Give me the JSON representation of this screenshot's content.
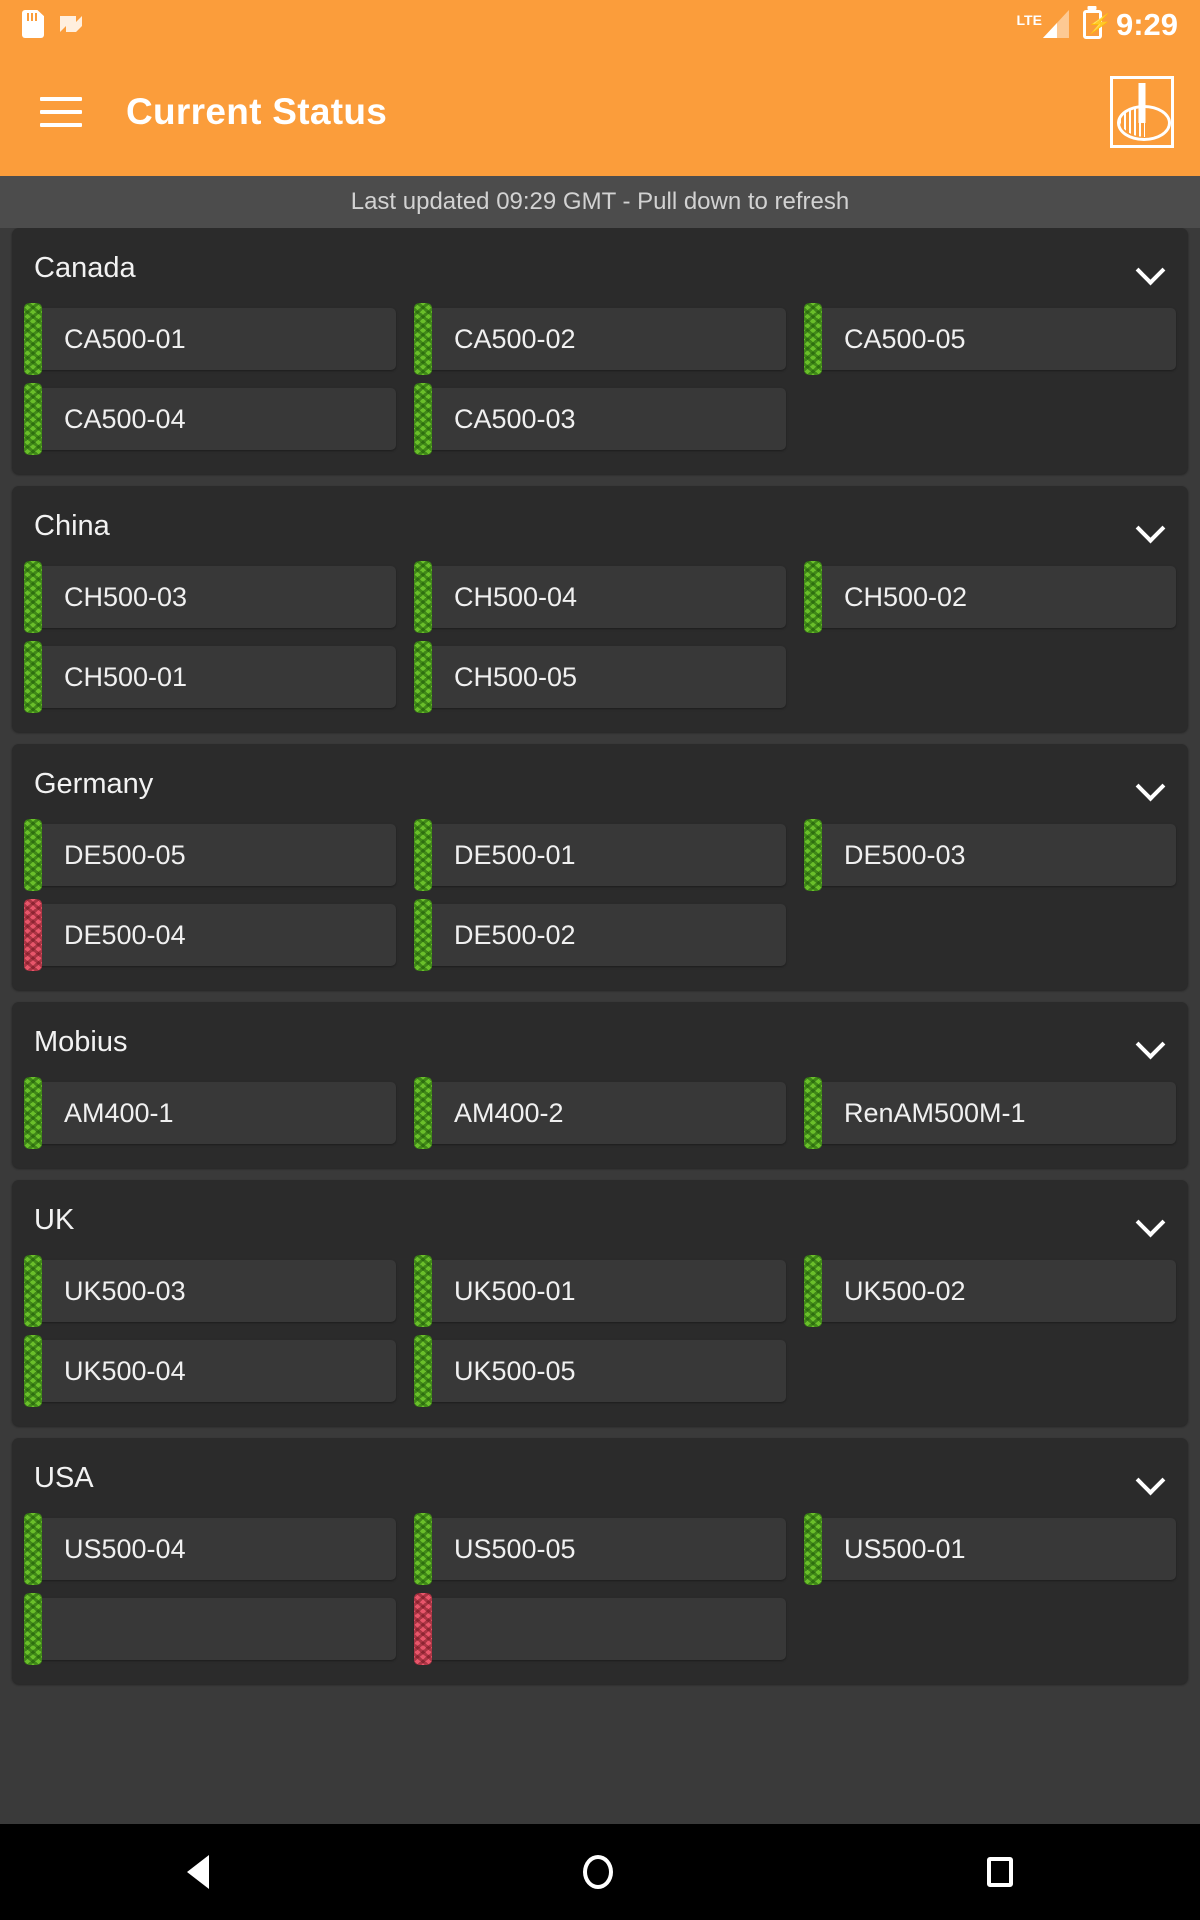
{
  "status_bar": {
    "sd_icon": "sd-card-icon",
    "nougat_icon": "android-nougat-icon",
    "network_label": "LTE",
    "signal_icon": "signal-bars-icon",
    "battery_icon": "battery-charging-icon",
    "time": "9:29"
  },
  "app_bar": {
    "menu_icon": "hamburger-menu-icon",
    "title": "Current Status",
    "logo_icon": "renishaw-logo-icon",
    "background_color": "#FB9D3B"
  },
  "refresh": {
    "text": "Last updated 09:29 GMT - Pull down to refresh"
  },
  "colors": {
    "accent": "#FB9D3B",
    "status_ok": "#6ABF2A",
    "status_error": "#E8566B",
    "group_bg": "#2b2b2b",
    "page_bg": "#3a3a3a",
    "machine_bg": "#383838"
  },
  "groups": [
    {
      "name": "Canada",
      "collapse_icon": "chevron-down-icon",
      "machines": [
        {
          "label": "CA500-01",
          "status": "ok"
        },
        {
          "label": "CA500-02",
          "status": "ok"
        },
        {
          "label": "CA500-05",
          "status": "ok"
        },
        {
          "label": "CA500-04",
          "status": "ok"
        },
        {
          "label": "CA500-03",
          "status": "ok"
        }
      ]
    },
    {
      "name": "China",
      "collapse_icon": "chevron-down-icon",
      "machines": [
        {
          "label": "CH500-03",
          "status": "ok"
        },
        {
          "label": "CH500-04",
          "status": "ok"
        },
        {
          "label": "CH500-02",
          "status": "ok"
        },
        {
          "label": "CH500-01",
          "status": "ok"
        },
        {
          "label": "CH500-05",
          "status": "ok"
        }
      ]
    },
    {
      "name": "Germany",
      "collapse_icon": "chevron-down-icon",
      "machines": [
        {
          "label": "DE500-05",
          "status": "ok"
        },
        {
          "label": "DE500-01",
          "status": "ok"
        },
        {
          "label": "DE500-03",
          "status": "ok"
        },
        {
          "label": "DE500-04",
          "status": "err"
        },
        {
          "label": "DE500-02",
          "status": "ok"
        }
      ]
    },
    {
      "name": "Mobius",
      "collapse_icon": "chevron-down-icon",
      "machines": [
        {
          "label": "AM400-1",
          "status": "ok"
        },
        {
          "label": "AM400-2",
          "status": "ok"
        },
        {
          "label": "RenAM500M-1",
          "status": "ok"
        }
      ]
    },
    {
      "name": "UK",
      "collapse_icon": "chevron-down-icon",
      "machines": [
        {
          "label": "UK500-03",
          "status": "ok"
        },
        {
          "label": "UK500-01",
          "status": "ok"
        },
        {
          "label": "UK500-02",
          "status": "ok"
        },
        {
          "label": "UK500-04",
          "status": "ok"
        },
        {
          "label": "UK500-05",
          "status": "ok"
        }
      ]
    },
    {
      "name": "USA",
      "collapse_icon": "chevron-down-icon",
      "machines": [
        {
          "label": "US500-04",
          "status": "ok"
        },
        {
          "label": "US500-05",
          "status": "ok"
        },
        {
          "label": "US500-01",
          "status": "ok"
        },
        {
          "label": "",
          "status": "ok"
        },
        {
          "label": "",
          "status": "err"
        }
      ]
    }
  ],
  "nav_bar": {
    "back_icon": "back-triangle-icon",
    "home_icon": "home-circle-icon",
    "recents_icon": "recents-square-icon"
  }
}
